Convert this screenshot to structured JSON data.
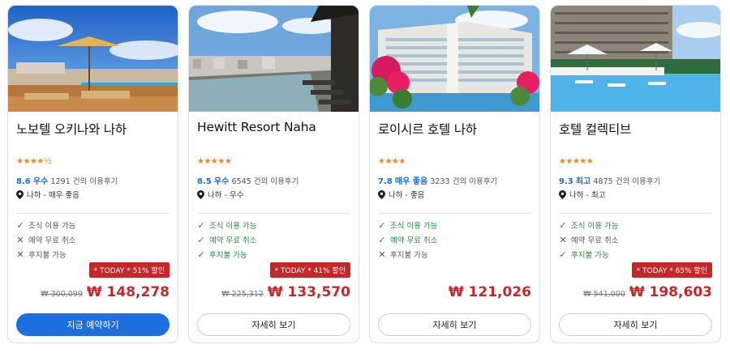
{
  "currency": "₩",
  "colors": {
    "accent": "#1d6fe0",
    "sale_red": "#c62828",
    "star": "#f5821f",
    "feature_ok": "#2a8a3e"
  },
  "hotels": [
    {
      "name": "노보텔 오키나와 나하",
      "stars_display": "★★★★½",
      "star_rating": 4.5,
      "score": "8.6",
      "score_label": "우수",
      "review_count": "1291",
      "review_suffix": "건의 이용후기",
      "location": "나하 - 매우 좋음",
      "features": [
        {
          "icon": "check-icon",
          "mark": "✓",
          "ok": true,
          "label": "조식 이용 가능"
        },
        {
          "icon": "x-icon",
          "mark": "✕",
          "ok": false,
          "label": "예약 무료 취소"
        },
        {
          "icon": "x-icon",
          "mark": "✕",
          "ok": false,
          "label": "후지불 가능"
        }
      ],
      "deal": "* TODAY * 51% 할인",
      "old_price": "₩ 300,099",
      "new_price": "₩ 148,278",
      "button": "지금 예약하기",
      "button_style": "primary"
    },
    {
      "name": "Hewitt Resort Naha",
      "stars_display": "★★★★★",
      "star_rating": 5,
      "score": "8.5",
      "score_label": "우수",
      "review_count": "6545",
      "review_suffix": "건의 이용후기",
      "location": "나하 - 우수",
      "features": [
        {
          "icon": "check-icon",
          "mark": "✓",
          "ok": true,
          "label": "조식 이용 가능"
        },
        {
          "icon": "check-icon",
          "mark": "✓",
          "ok": true,
          "label": "예약 무료 취소"
        },
        {
          "icon": "check-icon",
          "mark": "✓",
          "ok": true,
          "label": "후지불 가능"
        }
      ],
      "deal": "* TODAY * 41% 할인",
      "old_price": "₩ 225,312",
      "new_price": "₩ 133,570",
      "button": "자세히 보기",
      "button_style": "outline"
    },
    {
      "name": "로이시르 호텔 나하",
      "stars_display": "★★★★",
      "star_rating": 4,
      "score": "7.8",
      "score_label": "매우 좋음",
      "review_count": "3233",
      "review_suffix": "건의 이용후기",
      "location": "나하 - 좋음",
      "features": [
        {
          "icon": "check-icon",
          "mark": "✓",
          "ok": true,
          "label": "조식 이용 가능"
        },
        {
          "icon": "check-icon",
          "mark": "✓",
          "ok": true,
          "label": "예약 무료 취소"
        },
        {
          "icon": "x-icon",
          "mark": "✕",
          "ok": false,
          "label": "후지불 가능"
        }
      ],
      "deal": "",
      "old_price": "",
      "new_price": "₩ 121,026",
      "button": "자세히 보기",
      "button_style": "outline"
    },
    {
      "name": "호텔 컬렉티브",
      "stars_display": "★★★★★",
      "star_rating": 5,
      "score": "9.3",
      "score_label": "최고",
      "review_count": "4875",
      "review_suffix": "건의 이용후기",
      "location": "나하 - 최고",
      "features": [
        {
          "icon": "check-icon",
          "mark": "✓",
          "ok": true,
          "label": "조식 이용 가능"
        },
        {
          "icon": "x-icon",
          "mark": "✕",
          "ok": false,
          "label": "예약 무료 취소"
        },
        {
          "icon": "check-icon",
          "mark": "✓",
          "ok": true,
          "label": "후지불 가능"
        }
      ],
      "deal": "* TODAY * 65% 할인",
      "old_price": "₩ 541,000",
      "new_price": "₩ 198,603",
      "button": "자세히 보기",
      "button_style": "outline"
    }
  ]
}
